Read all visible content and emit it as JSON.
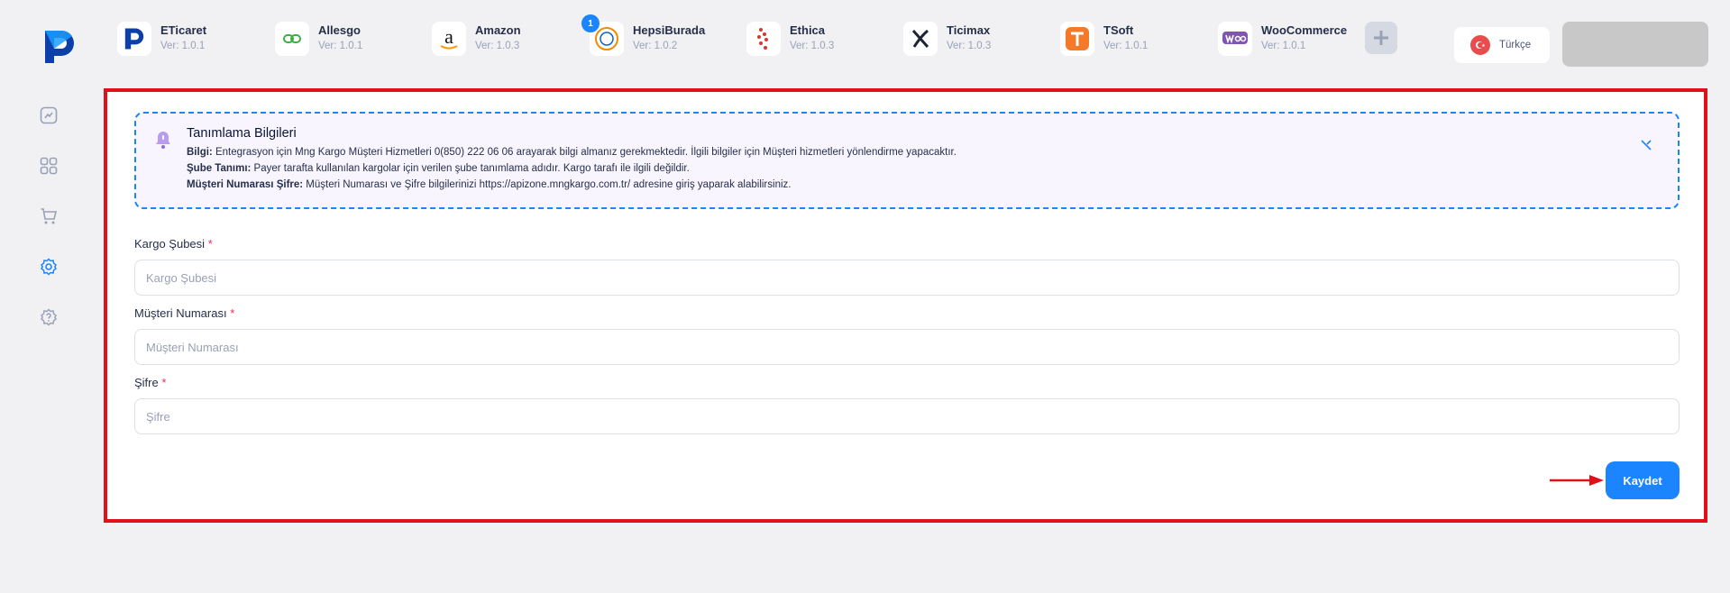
{
  "marketplaces": [
    {
      "name": "ETicaret",
      "version": "Ver: 1.0.1",
      "icon": "eticaret-logo-icon"
    },
    {
      "name": "Allesgo",
      "version": "Ver: 1.0.1",
      "icon": "allesgo-logo-icon"
    },
    {
      "name": "Amazon",
      "version": "Ver: 1.0.3",
      "icon": "amazon-logo-icon"
    },
    {
      "name": "HepsiBurada",
      "version": "Ver: 1.0.2",
      "icon": "hepsiburada-logo-icon",
      "badge": "1"
    },
    {
      "name": "Ethica",
      "version": "Ver: 1.0.3",
      "icon": "ethica-logo-icon"
    },
    {
      "name": "Ticimax",
      "version": "Ver: 1.0.3",
      "icon": "ticimax-logo-icon"
    },
    {
      "name": "TSoft",
      "version": "Ver: 1.0.1",
      "icon": "tsoft-logo-icon"
    },
    {
      "name": "WooCommerce",
      "version": "Ver: 1.0.1",
      "icon": "woocommerce-logo-icon"
    }
  ],
  "language": {
    "label": "Türkçe"
  },
  "info": {
    "title": "Tanımlama Bilgileri",
    "lines": [
      {
        "key": "Bilgi:",
        "text": " Entegrasyon için Mng Kargo Müşteri Hizmetleri 0(850) 222 06 06 arayarak bilgi almanız gerekmektedir. İlgili bilgiler için Müşteri hizmetleri yönlendirme yapacaktır."
      },
      {
        "key": "Şube Tanımı:",
        "text": " Payer tarafta kullanılan kargolar için verilen şube tanımlama adıdır. Kargo tarafı ile ilgili değildir."
      },
      {
        "key": "Müşteri Numarası Şifre:",
        "text": " Müşteri Numarası ve Şifre bilgilerinizi https://apizone.mngkargo.com.tr/ adresine giriş yaparak alabilirsiniz."
      }
    ]
  },
  "form": {
    "branch": {
      "label": "Kargo Şubesi",
      "required": "*",
      "placeholder": "Kargo Şubesi"
    },
    "customer": {
      "label": "Müşteri Numarası",
      "required": "*",
      "placeholder": "Müşteri Numarası"
    },
    "password": {
      "label": "Şifre",
      "required": "*",
      "placeholder": "Şifre"
    },
    "save_label": "Kaydet"
  },
  "colors": {
    "accent": "#1b84ff",
    "highlight": "#e00f1a",
    "required": "#f8285a"
  }
}
